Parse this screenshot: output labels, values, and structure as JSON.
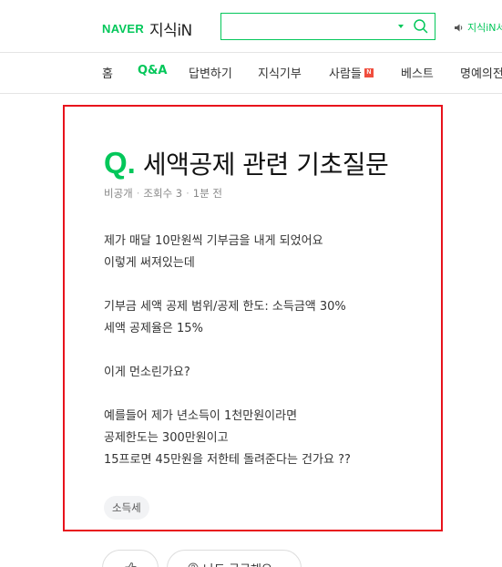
{
  "header": {
    "logo_brand": "NAVER",
    "logo_service": "지식iN",
    "search": {
      "value": "",
      "placeholder": ""
    },
    "link_label": "지식iN서",
    "accent_color": "#03c75a"
  },
  "nav": {
    "items": [
      {
        "label": "홈",
        "active": false
      },
      {
        "label": "Q&A",
        "active": true
      },
      {
        "label": "답변하기",
        "active": false
      },
      {
        "label": "지식기부",
        "active": false
      },
      {
        "label": "사람들",
        "active": false,
        "badge": "N"
      },
      {
        "label": "베스트",
        "active": false
      },
      {
        "label": "명예의전",
        "active": false
      }
    ]
  },
  "question": {
    "q_mark": "Q.",
    "title": "세액공제 관련 기초질문",
    "meta": {
      "visibility": "비공개",
      "views_label": "조회수 3",
      "time": "1분 전"
    },
    "body": [
      [
        "제가 매달 10만원씩 기부금을 내게 되었어요",
        "이렇게 써져있는데"
      ],
      [
        "기부금 세액 공제 범위/공제 한도: 소득금액 30%",
        "세액 공제율은 15%"
      ],
      [
        "이게 먼소린가요?"
      ],
      [
        "예를들어 제가 년소득이 1천만원이라면",
        "공제한도는 300만원이고",
        "15프로면 45만원을 저한테 돌려준다는 건가요 ??"
      ]
    ],
    "tag": "소득세",
    "highlight_color": "#e8121c"
  },
  "actions": {
    "curious_label": "나도 궁금해요"
  }
}
